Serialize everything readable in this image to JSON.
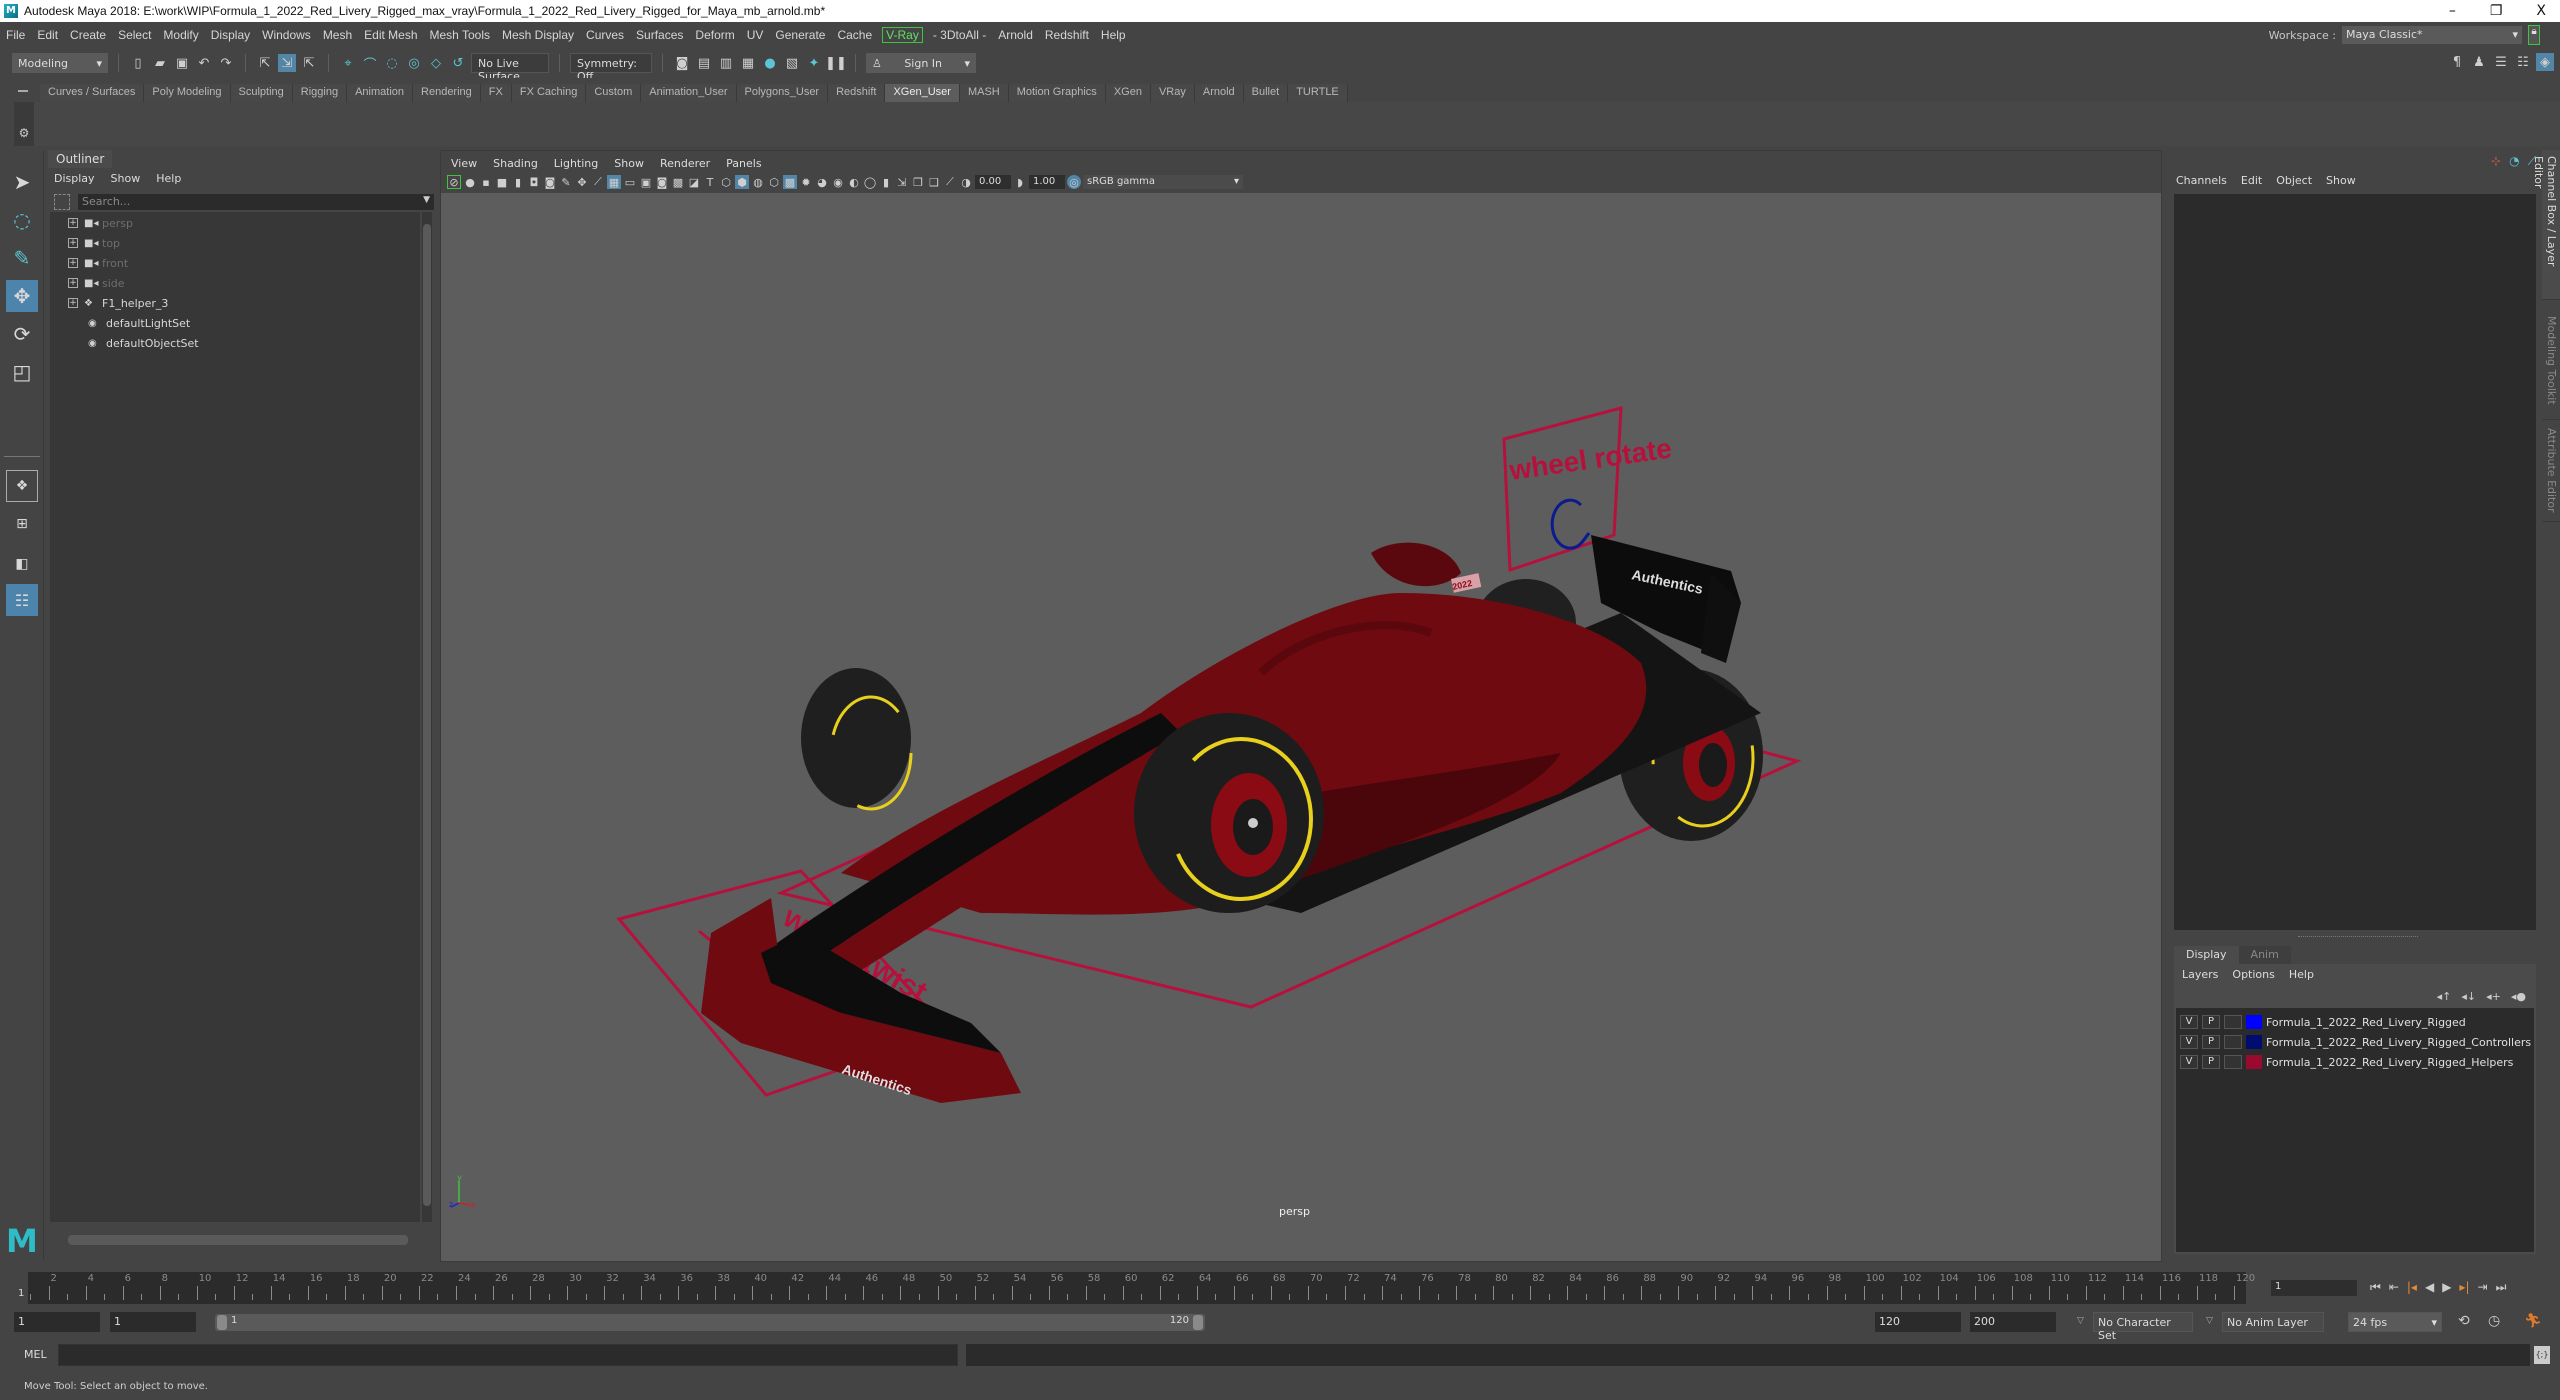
{
  "window": {
    "title": "Autodesk Maya 2018: E:\\work\\WIP\\Formula_1_2022_Red_Livery_Rigged_max_vray\\Formula_1_2022_Red_Livery_Rigged_for_Maya_mb_arnold.mb*",
    "minimize": "–",
    "restore": "❐",
    "close": "X"
  },
  "menubar": {
    "items": [
      "File",
      "Edit",
      "Create",
      "Select",
      "Modify",
      "Display",
      "Windows",
      "Mesh",
      "Edit Mesh",
      "Mesh Tools",
      "Mesh Display",
      "Curves",
      "Surfaces",
      "Deform",
      "UV",
      "Generate",
      "Cache",
      "V-Ray",
      "- 3DtoAll -",
      "Arnold",
      "Redshift",
      "Help"
    ],
    "workspace_label": "Workspace :",
    "workspace_value": "Maya Classic*"
  },
  "statusline": {
    "mode": "Modeling",
    "live_surface": "No Live Surface",
    "symmetry": "Symmetry: Off",
    "sign_in": "Sign In"
  },
  "shelf": {
    "tabs": [
      "Curves / Surfaces",
      "Poly Modeling",
      "Sculpting",
      "Rigging",
      "Animation",
      "Rendering",
      "FX",
      "FX Caching",
      "Custom",
      "Animation_User",
      "Polygons_User",
      "Redshift",
      "XGen_User",
      "MASH",
      "Motion Graphics",
      "XGen",
      "VRay",
      "Arnold",
      "Bullet",
      "TURTLE"
    ],
    "active_tab": "XGen_User"
  },
  "outliner": {
    "title": "Outliner",
    "menu": [
      "Display",
      "Show",
      "Help"
    ],
    "search_placeholder": "Search...",
    "items": [
      {
        "label": "persp",
        "icon": "camera-icon",
        "expandable": true,
        "dim": true
      },
      {
        "label": "top",
        "icon": "camera-icon",
        "expandable": true,
        "dim": true
      },
      {
        "label": "front",
        "icon": "camera-icon",
        "expandable": true,
        "dim": true
      },
      {
        "label": "side",
        "icon": "camera-icon",
        "expandable": true,
        "dim": true
      },
      {
        "label": "F1_helper_3",
        "icon": "transform-group-icon",
        "expandable": true,
        "dim": false
      },
      {
        "label": "defaultLightSet",
        "icon": "set-icon",
        "expandable": false,
        "dim": false
      },
      {
        "label": "defaultObjectSet",
        "icon": "set-icon",
        "expandable": false,
        "dim": false
      }
    ]
  },
  "viewport": {
    "menu": [
      "View",
      "Shading",
      "Lighting",
      "Show",
      "Renderer",
      "Panels"
    ],
    "exposure": "0.00",
    "gamma": "1.00",
    "color_space": "sRGB gamma",
    "camera_label": "persp",
    "scene_labels": {
      "wheel_rotate": "wheel rotate",
      "wheel_twist": "wheel twist",
      "sponsor": "Authentics",
      "year": "2022"
    },
    "colors": {
      "background": "#5d5d5d",
      "helper_red": "#b5113c",
      "controller_blue": "#0b1a8c",
      "car_body": "#6e0a10",
      "tyre_stripe": "#e8d01c"
    }
  },
  "channelbox": {
    "menu": [
      "Channels",
      "Edit",
      "Object",
      "Show"
    ]
  },
  "layer_editor": {
    "tabs": [
      "Display",
      "Anim"
    ],
    "active_tab": "Display",
    "menu": [
      "Layers",
      "Options",
      "Help"
    ],
    "layers": [
      {
        "v": "V",
        "p": "P",
        "color": "#0000ff",
        "name": "Formula_1_2022_Red_Livery_Rigged"
      },
      {
        "v": "V",
        "p": "P",
        "color": "#000c6e",
        "name": "Formula_1_2022_Red_Livery_Rigged_Controllers"
      },
      {
        "v": "V",
        "p": "P",
        "color": "#9a0a2e",
        "name": "Formula_1_2022_Red_Livery_Rigged_Helpers"
      }
    ]
  },
  "side_tabs": [
    "Channel Box / Layer Editor",
    "Modeling Toolkit",
    "Attribute Editor"
  ],
  "timeline": {
    "ticks": [
      2,
      4,
      6,
      8,
      10,
      12,
      14,
      16,
      18,
      20,
      22,
      24,
      26,
      28,
      30,
      32,
      34,
      36,
      38,
      40,
      42,
      44,
      46,
      48,
      50,
      52,
      54,
      56,
      58,
      60,
      62,
      64,
      66,
      68,
      70,
      72,
      74,
      76,
      78,
      80,
      82,
      84,
      86,
      88,
      90,
      92,
      94,
      96,
      98,
      100,
      102,
      104,
      106,
      108,
      110,
      112,
      114,
      116,
      118,
      120
    ],
    "start": 1,
    "end": 120,
    "current_frame": "1"
  },
  "range": {
    "anim_start": "1",
    "playback_start": "1",
    "slider_start": "1",
    "slider_end": "120",
    "playback_end": "120",
    "anim_end": "200",
    "character_set": "No Character Set",
    "anim_layer": "No Anim Layer",
    "fps": "24 fps"
  },
  "cmdline": {
    "label": "MEL"
  },
  "helpline": {
    "text": "Move Tool: Select an object to move."
  }
}
